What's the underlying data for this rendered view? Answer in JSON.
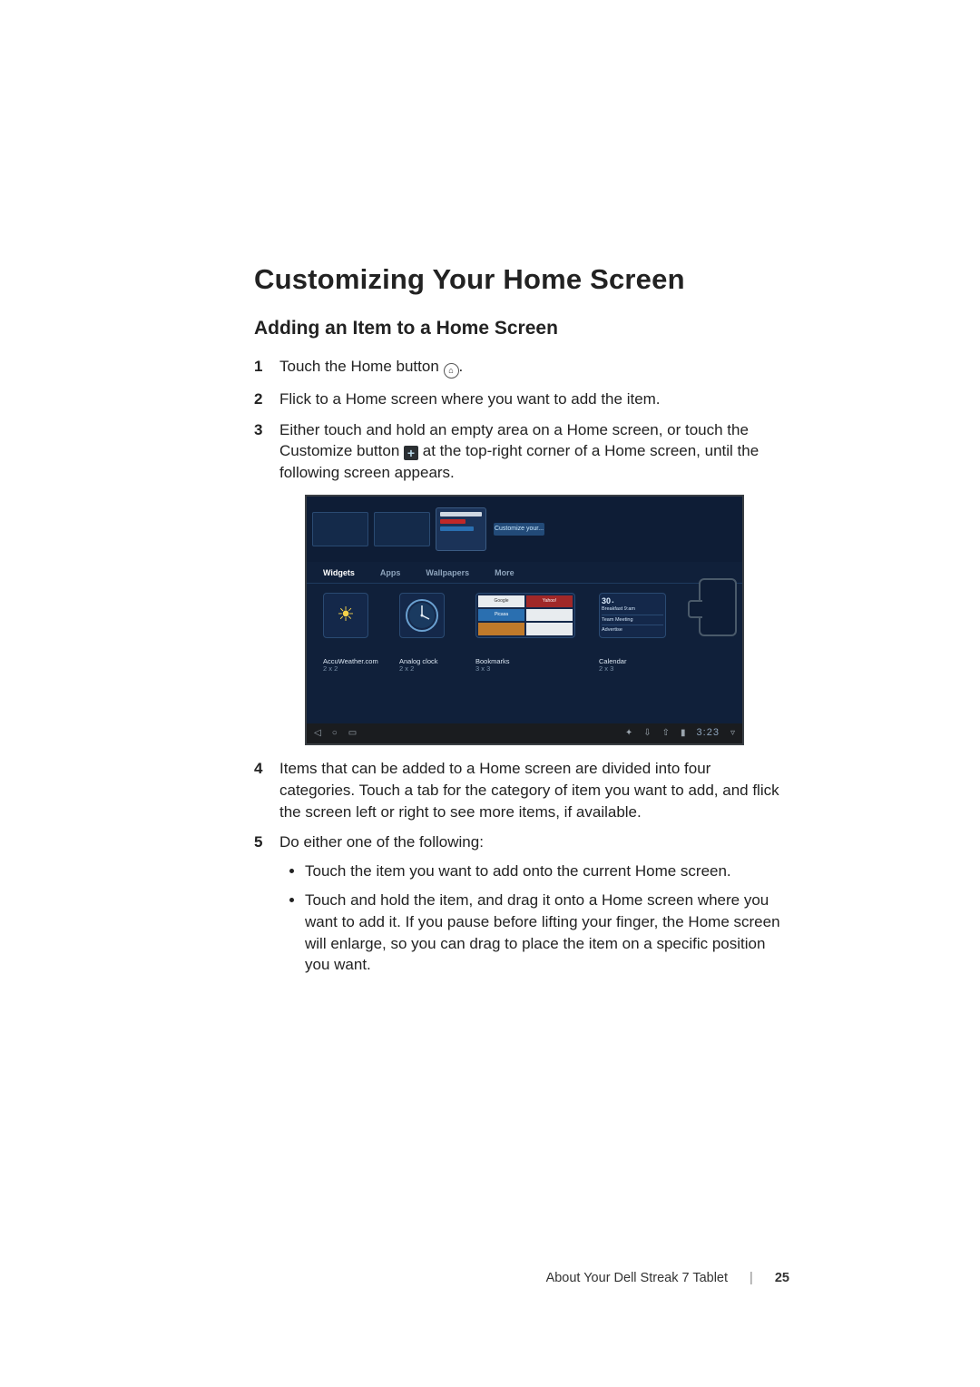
{
  "heading": "Customizing Your Home Screen",
  "subheading": "Adding an Item to a Home Screen",
  "steps": {
    "s1a": "Touch the Home button ",
    "s1b": ".",
    "s2": "Flick to a Home screen where you want to add the item.",
    "s3a": "Either touch and hold an empty area on a Home screen, or touch the Customize button ",
    "s3b": " at the top-right corner of a Home screen, until the following screen appears.",
    "s4": "Items that can be added to a Home screen are divided into four categories. Touch a tab for the category of item you want to add, and flick the screen left or right to see more items, if available.",
    "s5": "Do either one of the following:",
    "s5a": "Touch the item you want to add onto the current Home screen.",
    "s5b": "Touch and hold the item, and drag it onto a Home screen where you want to add it. If you pause before lifting your finger, the Home screen will enlarge, so you can drag to place the item on a specific position you want."
  },
  "screenshot": {
    "topButton": "Customize your...",
    "tabs": {
      "widgets": "Widgets",
      "apps": "Apps",
      "wallpapers": "Wallpapers",
      "more": "More"
    },
    "widgets": {
      "accu": {
        "name": "AccuWeather.com",
        "size": "2 x 2"
      },
      "clock": {
        "name": "Analog clock",
        "size": "2 x 2"
      },
      "bookmarks": {
        "name": "Bookmarks",
        "size": "3 x 3"
      },
      "calendar": {
        "name": "Calendar",
        "size": "2 x 3"
      }
    },
    "calendar": {
      "day": "30",
      "e1": "Breakfast 9:am",
      "e2": "Team Meeting",
      "e3": "Advertise"
    },
    "bookmark_labels": {
      "google": "Google",
      "yahoo": "Yahoo!",
      "picasa": "Picasa"
    },
    "sysbar": {
      "time": "3:23"
    }
  },
  "footer": {
    "label": "About Your Dell Streak 7 Tablet",
    "page": "25"
  }
}
